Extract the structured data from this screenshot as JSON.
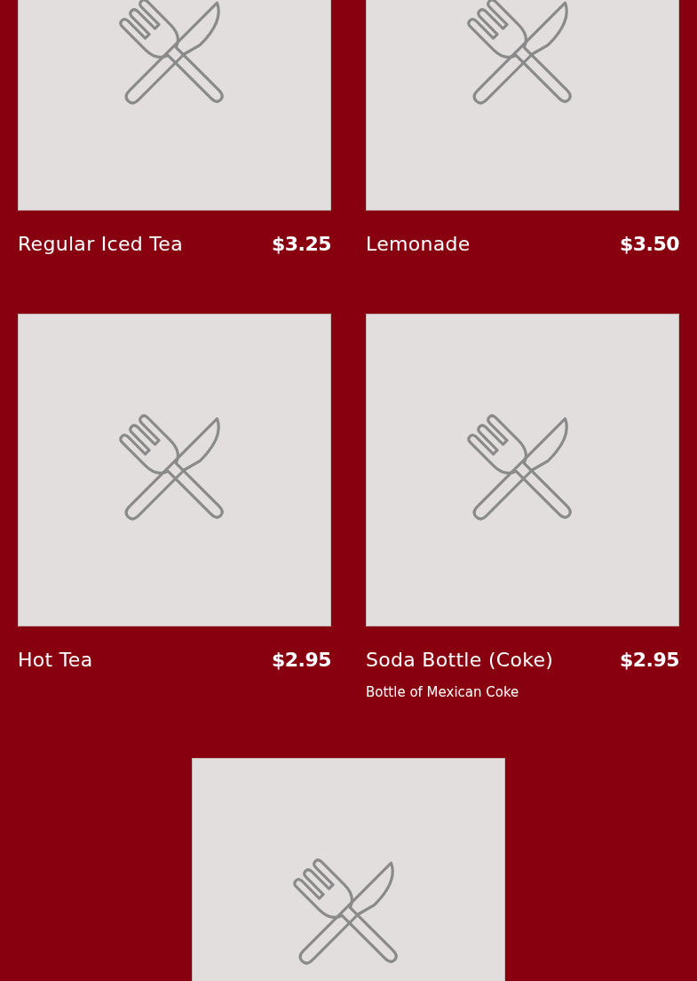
{
  "menu_items": [
    {
      "has_image": true,
      "name": "Regular Iced Tea",
      "price": "$3.25"
    },
    {
      "has_image": true,
      "name": "Lemonade",
      "price": "$3.50"
    },
    {
      "has_image": true,
      "name": "Hot Tea",
      "price": "$2.95"
    },
    {
      "has_image": true,
      "name": "Soda Bottle (Coke)",
      "price": "$2.95",
      "description": "Bottle of Mexican Coke"
    },
    {
      "has_image": true
    }
  ]
}
